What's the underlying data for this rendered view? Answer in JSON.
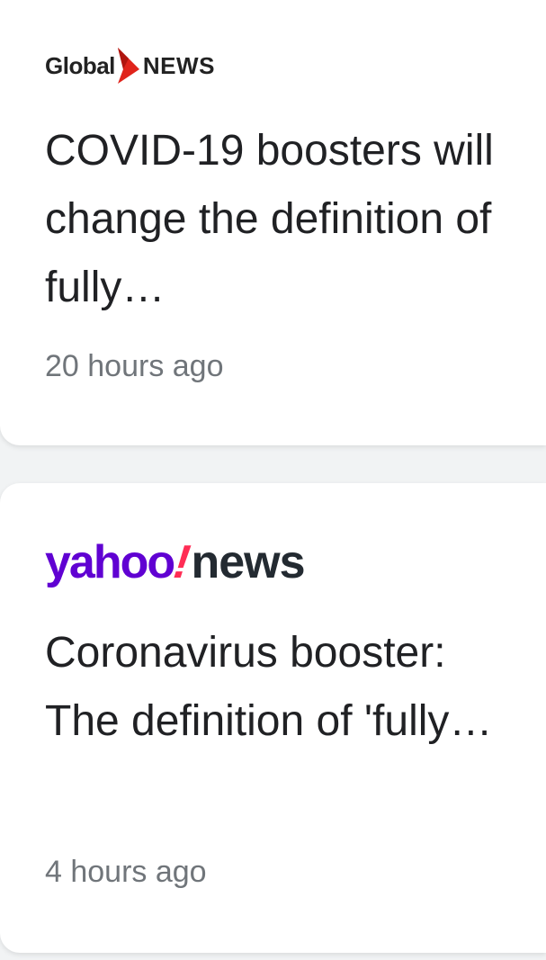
{
  "articles": [
    {
      "source": {
        "word1": "Global",
        "word2": "NEWS"
      },
      "headline": "COVID-19 boosters will change the definition of fully…",
      "time": "20 hours ago"
    },
    {
      "source": {
        "word1": "yahoo",
        "mark": "!",
        "word2": "news"
      },
      "headline": "Coronavirus booster: The definition of 'fully…",
      "time": "4 hours ago"
    }
  ],
  "colors": {
    "global_red": "#e0241b",
    "yahoo_purple": "#6001d2",
    "yahoo_pink": "#ff2d55",
    "headline": "#202124",
    "timestamp": "#70757a"
  }
}
